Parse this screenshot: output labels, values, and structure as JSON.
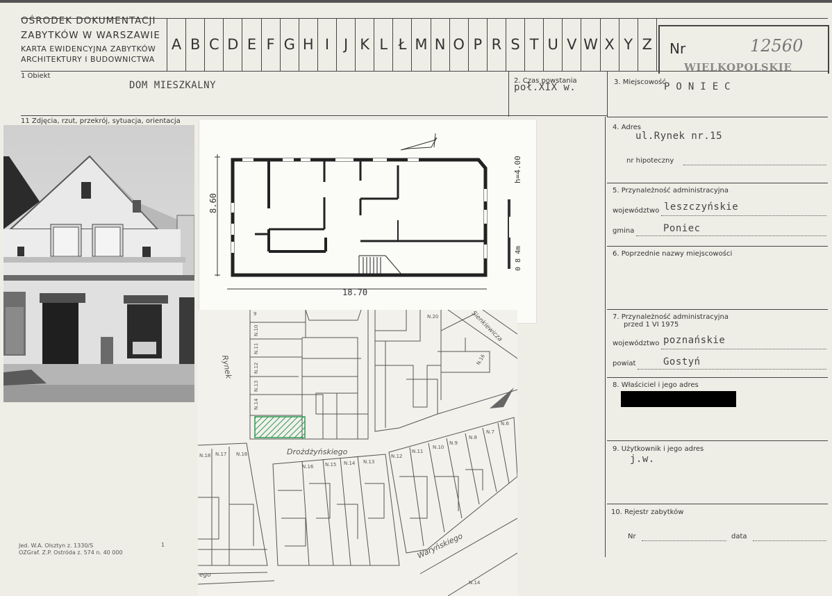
{
  "header": {
    "org_line1": "OŚRODEK DOKUMENTACJI",
    "org_line2": "ZABYTKÓW W WARSZAWIE",
    "card_line1": "KARTA EWIDENCYJNA ZABYTKÓW",
    "card_line2": "ARCHITEKTURY I BUDOWNICTWA",
    "letters": [
      "A",
      "B",
      "C",
      "D",
      "E",
      "F",
      "G",
      "H",
      "I",
      "J",
      "K",
      "L",
      "Ł",
      "M",
      "N",
      "O",
      "P",
      "R",
      "S",
      "T",
      "U",
      "V",
      "W",
      "X",
      "Y",
      "Z"
    ],
    "nr_label": "Nr",
    "nr_value": "12560",
    "stamp": "WIELKOPOLSKIE"
  },
  "fields": {
    "obiekt_label": "1 Obiekt",
    "obiekt_value": "DOM MIESZKALNY",
    "czas_label": "2. Czas powstania",
    "czas_value": "poł.XIX w.",
    "miejscowosc_label": "3. Miejscowość",
    "miejscowosc_value": "PONIEC",
    "zdjecia_label": "11 Zdjęcia, rzut, przekrój, sytuacja, orientacja",
    "adres_label": "4. Adres",
    "adres_value": "ul.Rynek nr.15",
    "hipoteczny_label": "nr hipoteczny",
    "przynaleznosc_label": "5. Przynależność administracyjna",
    "wojewodztwo_label": "województwo",
    "wojewodztwo_value": "leszczyńskie",
    "gmina_label": "gmina",
    "gmina_value": "Poniec",
    "poprzednie_label": "6. Poprzednie nazwy miejscowości",
    "przyn1975_label1": "7. Przynależność administracyjna",
    "przyn1975_label2": "przed 1 VI 1975",
    "woj1975_label": "województwo",
    "woj1975_value": "poznańskie",
    "powiat_label": "powiat",
    "powiat_value": "Gostyń",
    "wlasciciel_label": "8. Właściciel i jego adres",
    "uzytkownik_label": "9. Użytkownik i jego adres",
    "uzytkownik_value": "j.w.",
    "rejestr_label": "10. Rejestr zabytków",
    "nr_label": "Nr",
    "data_label": "data",
    "imprint_line1": "Jed. W.A. Olsztyn z. 1330/S",
    "imprint_line2": "OZGraf. Z.P. Ostróda z. 574 n. 40 000",
    "imprint_mark": "1"
  },
  "plan": {
    "width_label": "18.70",
    "depth_label": "8.60",
    "height_label": "h=4.00",
    "scale_label": "0 8 4m"
  },
  "map": {
    "street_rynek": "Rynek",
    "street_drozdzynskiego": "Drożdżyńskiego",
    "street_warynskiego": "Waryńskiego",
    "street_sienkiewicza": "Sienkiewicza",
    "street_partial": "ego",
    "plot_labels": [
      "9",
      "N.10",
      "N.11",
      "N.12",
      "N.13",
      "N.14",
      "N.20",
      "N.16",
      "N.16",
      "N.15",
      "N.14",
      "N.13",
      "N.12",
      "N.11",
      "N.10",
      "N.9",
      "N.8",
      "N.7",
      "N.6",
      "N.18",
      "N.17",
      "N.16",
      "N.14"
    ]
  }
}
